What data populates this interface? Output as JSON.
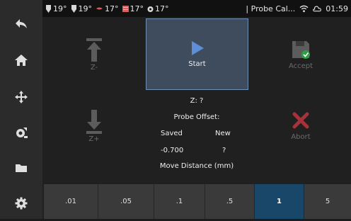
{
  "status": {
    "temps": [
      {
        "icon": "extruder-icon",
        "value": "19°"
      },
      {
        "icon": "extruder-icon",
        "value": "19°"
      },
      {
        "icon": "heater-icon",
        "value": "17°"
      },
      {
        "icon": "heatbed-icon",
        "value": "17°"
      },
      {
        "icon": "mcu-icon",
        "value": "17°"
      }
    ],
    "title": "| Probe Cal...",
    "time": "01:59"
  },
  "sidebar": {
    "items": [
      "back-icon",
      "home-icon",
      "move-icon",
      "extrude-icon",
      "folder-icon",
      "settings-icon"
    ]
  },
  "buttons": {
    "z_minus": "Z-",
    "z_plus": "Z+",
    "start": "Start",
    "accept": "Accept",
    "abort": "Abort"
  },
  "probe": {
    "z_line": "Z: ?",
    "offset_title": "Probe Offset:",
    "saved_label": "Saved",
    "new_label": "New",
    "saved_value": "-0.700",
    "new_value": "?"
  },
  "move_distance": {
    "label": "Move Distance (mm)",
    "options": [
      ".01",
      ".05",
      ".1",
      ".5",
      "1",
      "5"
    ],
    "selected": "1"
  },
  "colors": {
    "accent": "#19476a",
    "start_bg": "#3e4c5e",
    "start_icon": "#5e8fd6",
    "accept_green": "#2f9e44",
    "abort_red": "#a8323a"
  }
}
